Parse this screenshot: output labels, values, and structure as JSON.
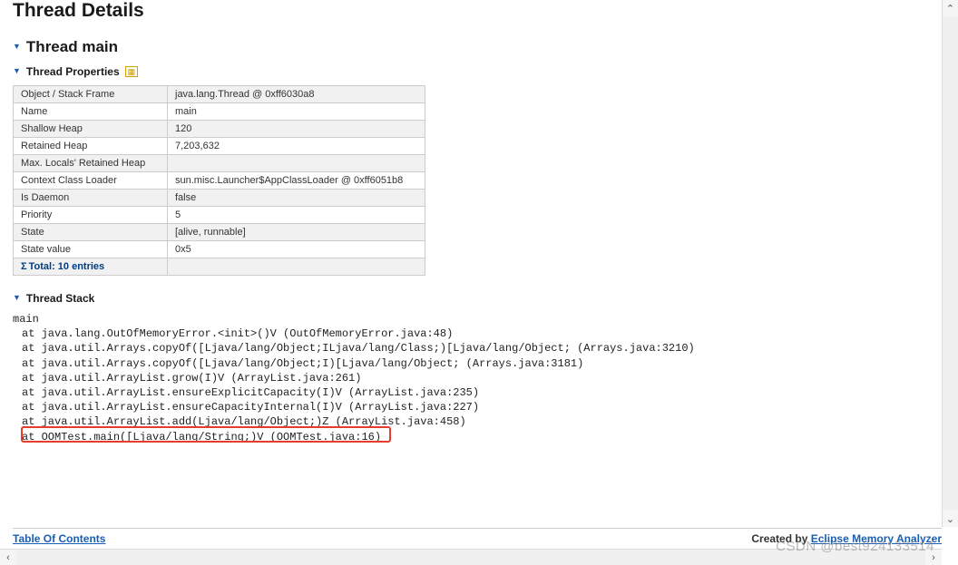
{
  "page_title": "Thread Details",
  "thread": {
    "title": "Thread main",
    "sections": {
      "properties": {
        "title": "Thread Properties",
        "rows": [
          {
            "label": "Object / Stack Frame",
            "value": "java.lang.Thread @ 0xff6030a8"
          },
          {
            "label": "Name",
            "value": "main"
          },
          {
            "label": "Shallow Heap",
            "value": "120"
          },
          {
            "label": "Retained Heap",
            "value": "7,203,632"
          },
          {
            "label": "Max. Locals' Retained Heap",
            "value": ""
          },
          {
            "label": "Context Class Loader",
            "value": "sun.misc.Launcher$AppClassLoader @ 0xff6051b8"
          },
          {
            "label": "Is Daemon",
            "value": "false"
          },
          {
            "label": "Priority",
            "value": "5"
          },
          {
            "label": "State",
            "value": "[alive, runnable]"
          },
          {
            "label": "State value",
            "value": "0x5"
          }
        ],
        "total": "Total: 10 entries"
      },
      "stack": {
        "title": "Thread Stack",
        "head": "main",
        "frames": [
          "at java.lang.OutOfMemoryError.<init>()V (OutOfMemoryError.java:48)",
          "at java.util.Arrays.copyOf([Ljava/lang/Object;ILjava/lang/Class;)[Ljava/lang/Object; (Arrays.java:3210)",
          "at java.util.Arrays.copyOf([Ljava/lang/Object;I)[Ljava/lang/Object; (Arrays.java:3181)",
          "at java.util.ArrayList.grow(I)V (ArrayList.java:261)",
          "at java.util.ArrayList.ensureExplicitCapacity(I)V (ArrayList.java:235)",
          "at java.util.ArrayList.ensureCapacityInternal(I)V (ArrayList.java:227)",
          "at java.util.ArrayList.add(Ljava/lang/Object;)Z (ArrayList.java:458)",
          "at OOMTest.main([Ljava/lang/String;)V (OOMTest.java:16)"
        ],
        "highlight_index": 7
      }
    }
  },
  "footer": {
    "toc": "Table Of Contents",
    "created_by": "Created by ",
    "tool": "Eclipse Memory Analyzer"
  },
  "watermark": "CSDN @best924133514"
}
